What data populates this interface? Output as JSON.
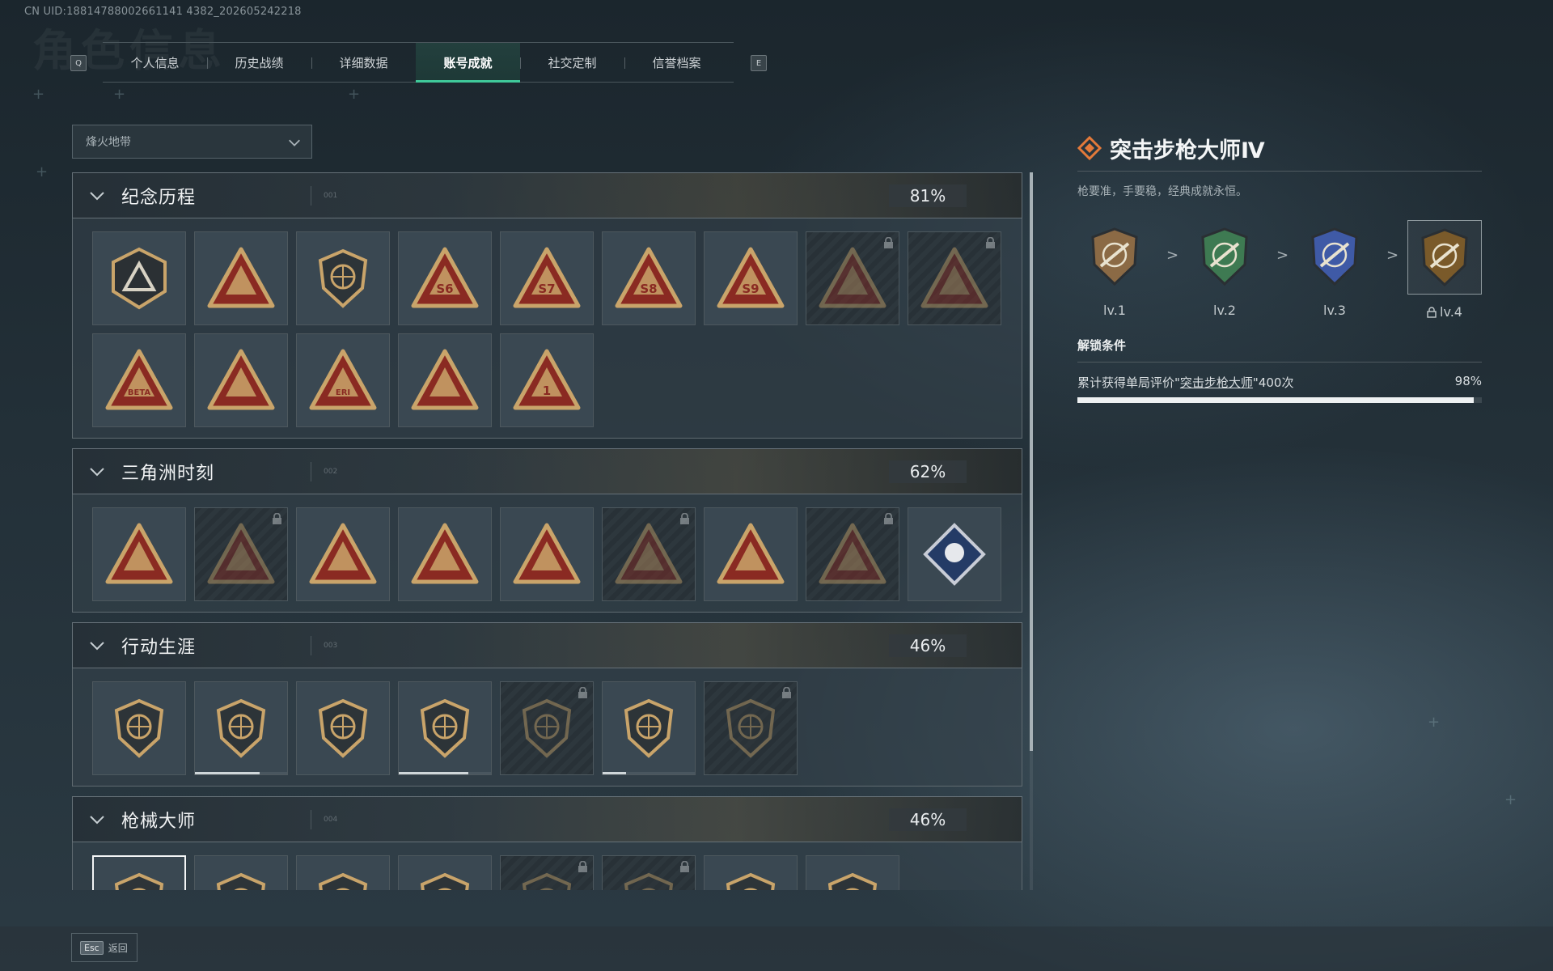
{
  "uid": "CN UID:18814788002661141 4382_202605242218",
  "header": {
    "ghost_title": "角色信息"
  },
  "keys": {
    "prev": "Q",
    "next": "E"
  },
  "tabs": [
    {
      "label": "个人信息",
      "active": false
    },
    {
      "label": "历史战绩",
      "active": false
    },
    {
      "label": "详细数据",
      "active": false
    },
    {
      "label": "账号成就",
      "active": true
    },
    {
      "label": "社交定制",
      "active": false
    },
    {
      "label": "信誉档案",
      "active": false
    }
  ],
  "filter": {
    "selected": "烽火地带"
  },
  "sections": [
    {
      "title": "纪念历程",
      "num": "001",
      "percent": "81%",
      "badges": [
        {
          "icon": "triangle-shield-icon",
          "locked": false
        },
        {
          "icon": "helicopter-badge-icon",
          "locked": false
        },
        {
          "icon": "hexagon-emblem-icon",
          "locked": false
        },
        {
          "icon": "season-s6-badge-icon",
          "text": "S6",
          "locked": false
        },
        {
          "icon": "season-s7-badge-icon",
          "text": "S7",
          "locked": false
        },
        {
          "icon": "season-s8-badge-icon",
          "text": "S8",
          "locked": false
        },
        {
          "icon": "season-s9-badge-icon",
          "text": "S9",
          "locked": false
        },
        {
          "icon": "operator-portrait-badge-icon",
          "locked": true
        },
        {
          "icon": "crossed-arms-badge-icon",
          "locked": true
        },
        {
          "icon": "beta-badge-icon",
          "text": "BETA",
          "locked": false
        },
        {
          "icon": "aircraft-badge-icon",
          "locked": false
        },
        {
          "icon": "eri-globe-badge-icon",
          "text": "ERI",
          "locked": false
        },
        {
          "icon": "eagle-badge-icon",
          "locked": false
        },
        {
          "icon": "number-one-badge-icon",
          "text": "1",
          "locked": false
        }
      ]
    },
    {
      "title": "三角洲时刻",
      "num": "002",
      "percent": "62%",
      "badges": [
        {
          "icon": "usb-drive-badge-icon",
          "locked": false
        },
        {
          "icon": "backpack-badge-icon",
          "locked": true
        },
        {
          "icon": "soldier-kneel-badge-icon",
          "locked": false
        },
        {
          "icon": "dice-badge-icon",
          "locked": false
        },
        {
          "icon": "squad-badge-icon",
          "locked": false
        },
        {
          "icon": "warrior-badge-icon",
          "locked": true
        },
        {
          "icon": "rocket-badge-icon",
          "locked": false
        },
        {
          "icon": "dragon-badge-icon",
          "locked": true
        },
        {
          "icon": "rose-diamond-badge-icon",
          "locked": false
        }
      ]
    },
    {
      "title": "行动生涯",
      "num": "003",
      "percent": "46%",
      "badges": [
        {
          "icon": "star-skull-medal-icon",
          "locked": false
        },
        {
          "icon": "shield-medal-icon",
          "locked": false,
          "progress": 0.7
        },
        {
          "icon": "gold-star-crest-icon",
          "locked": false
        },
        {
          "icon": "blue-star-crest-icon",
          "locked": false,
          "progress": 0.75
        },
        {
          "icon": "round-emblem-icon",
          "locked": true
        },
        {
          "icon": "skull-crosshair-medal-icon",
          "locked": false,
          "progress": 0.25
        },
        {
          "icon": "eye-emblem-icon",
          "locked": true
        }
      ]
    },
    {
      "title": "枪械大师",
      "num": "004",
      "percent": "46%",
      "badges": [
        {
          "icon": "rifle-master-icon",
          "locked": false,
          "selected": true
        },
        {
          "icon": "pistol-master-icon",
          "locked": false
        },
        {
          "icon": "sniper-master-icon",
          "locked": false
        },
        {
          "icon": "smg-master-icon",
          "locked": false
        },
        {
          "icon": "lmg-master-icon",
          "locked": true
        },
        {
          "icon": "shotgun-master-icon",
          "locked": true
        },
        {
          "icon": "dmr-master-icon",
          "locked": false
        },
        {
          "icon": "carbine-master-icon",
          "locked": false
        }
      ]
    }
  ],
  "detail": {
    "title": "突击步枪大师Ⅳ",
    "description": "枪要准，手要稳，经典成就永恒。",
    "levels": [
      {
        "label": "lv.1",
        "color": "#8b6a45",
        "locked": false
      },
      {
        "label": "lv.2",
        "color": "#3e7a52",
        "locked": false
      },
      {
        "label": "lv.3",
        "color": "#3f5aa6",
        "locked": false
      },
      {
        "label": "lv.4",
        "color": "#7a5a2a",
        "locked": true
      }
    ],
    "condition_title": "解锁条件",
    "condition_prefix": "累计获得单局评价\"",
    "condition_link": "突击步枪大师",
    "condition_suffix": "\"400次",
    "condition_percent": "98%",
    "progress": 0.98
  },
  "footer": {
    "esc_key": "Esc",
    "back_label": "返回"
  },
  "colors": {
    "accent": "#3fc99a",
    "gold": "#c9a46a",
    "red": "#8a2a22"
  }
}
